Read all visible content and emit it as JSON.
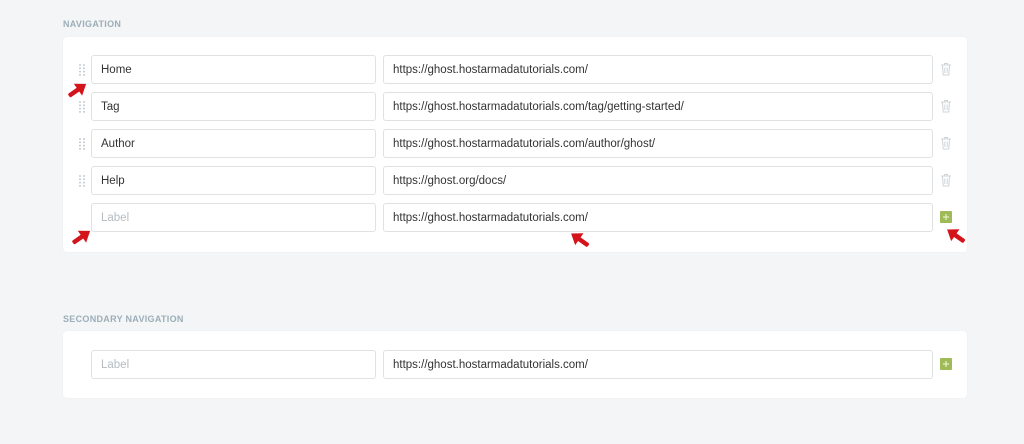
{
  "navigation": {
    "title": "NAVIGATION",
    "items": [
      {
        "label": "Home",
        "url": "https://ghost.hostarmadatutorials.com/"
      },
      {
        "label": "Tag",
        "url": "https://ghost.hostarmadatutorials.com/tag/getting-started/"
      },
      {
        "label": "Author",
        "url": "https://ghost.hostarmadatutorials.com/author/ghost/"
      },
      {
        "label": "Help",
        "url": "https://ghost.org/docs/"
      }
    ],
    "new_item": {
      "label_placeholder": "Label",
      "url": "https://ghost.hostarmadatutorials.com/"
    }
  },
  "secondary_navigation": {
    "title": "SECONDARY NAVIGATION",
    "new_item": {
      "label_placeholder": "Label",
      "url": "https://ghost.hostarmadatutorials.com/"
    }
  },
  "icons": {
    "drag": "drag-handle-icon",
    "delete": "trash-icon",
    "add": "plus-icon",
    "annotation": "red-arrow-icon"
  },
  "colors": {
    "background": "#f4f5f6",
    "add_button": "#9fbb58",
    "annotation_arrow": "#d4141b",
    "section_title": "#9baeb8"
  }
}
